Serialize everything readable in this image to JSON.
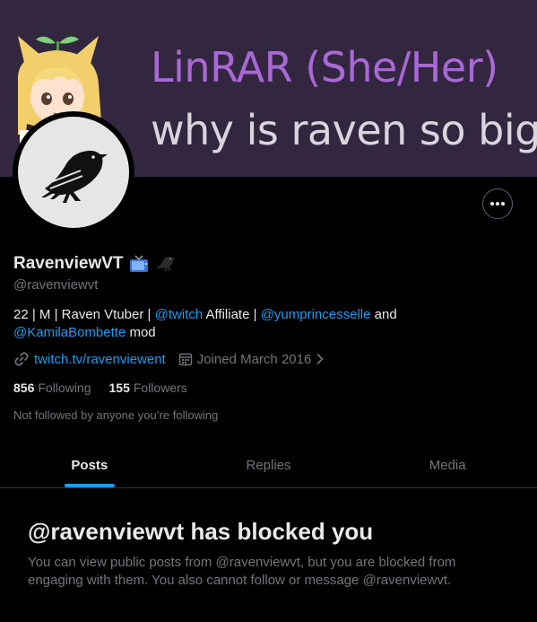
{
  "banner": {
    "title": "LinRAR (She/Her)",
    "subtitle": "why is raven so big"
  },
  "profile": {
    "display_name": "RavenviewVT",
    "handle": "@ravenviewvt",
    "name_emojis": [
      "tv-icon",
      "bird-icon"
    ],
    "bio": {
      "part1": "22 | M | Raven Vtuber | ",
      "mention1": "@twitch",
      "part2": " Affiliate | ",
      "mention2": "@yumprincesselle",
      "part3": " and ",
      "mention3": "@KamilaBombette",
      "part4": " mod"
    },
    "website": "twitch.tv/ravenviewent",
    "joined": "Joined March 2016",
    "following_count": "856",
    "following_label": "Following",
    "followers_count": "155",
    "followers_label": "Followers",
    "not_followed": "Not followed by anyone you’re following"
  },
  "tabs": [
    {
      "label": "Posts",
      "active": true
    },
    {
      "label": "Replies",
      "active": false
    },
    {
      "label": "Media",
      "active": false
    }
  ],
  "blocked": {
    "title": "@ravenviewvt has blocked you",
    "message": "You can view public posts from @ravenviewvt, but you are blocked from engaging with them. You also cannot follow or message @ravenviewvt."
  },
  "colors": {
    "accent": "#1d9bf0",
    "banner_bg": "#332740",
    "banner_title": "#a968d6"
  }
}
